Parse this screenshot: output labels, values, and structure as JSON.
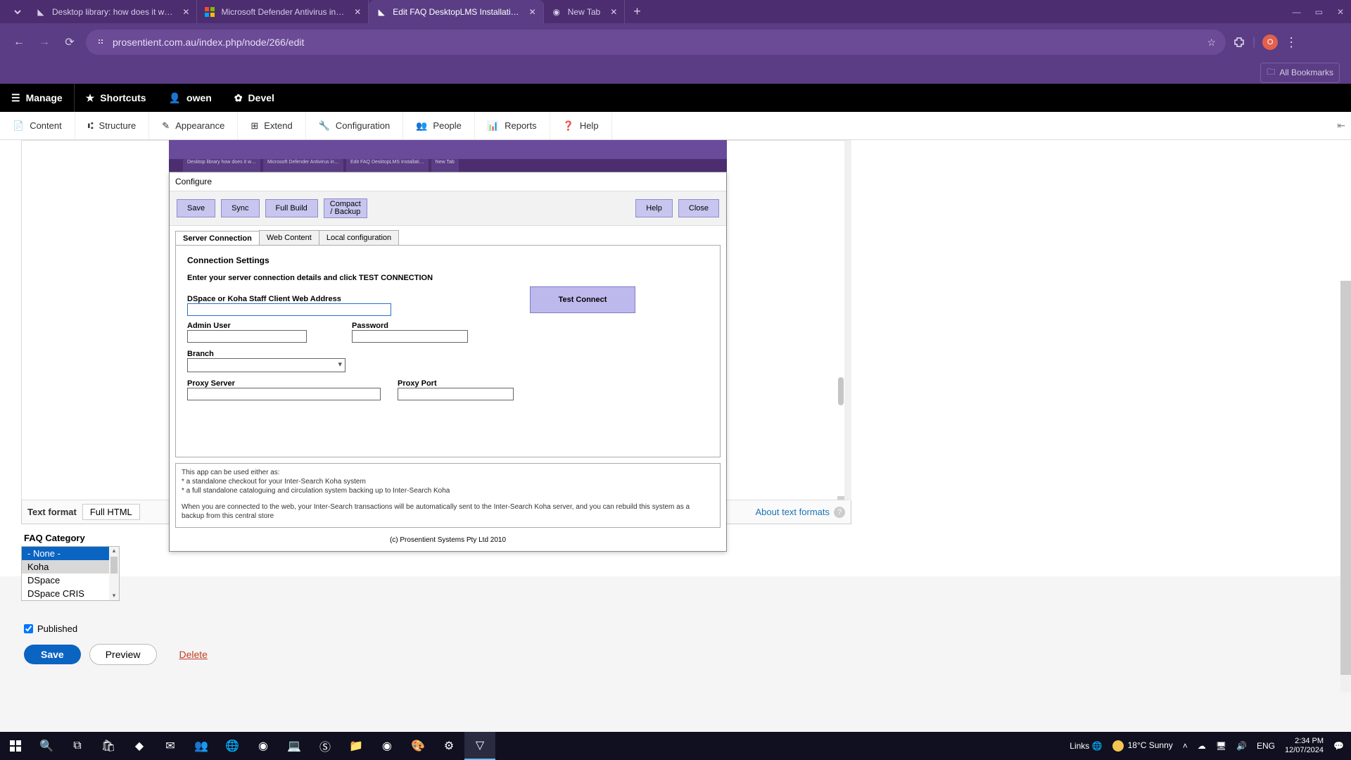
{
  "browser": {
    "tabs": [
      {
        "title": "Desktop library: how does it w…",
        "favicon": "◣"
      },
      {
        "title": "Microsoft Defender Antivirus in…",
        "favicon": "⊞"
      },
      {
        "title": "Edit FAQ DesktopLMS Installati…",
        "favicon": "◣",
        "active": true
      },
      {
        "title": "New Tab",
        "favicon": "◉"
      }
    ],
    "url": "prosentient.com.au/index.php/node/266/edit",
    "bookmarks_label": "All Bookmarks",
    "profile_initial": "O"
  },
  "drupal_bar": {
    "manage": "Manage",
    "shortcuts": "Shortcuts",
    "user": "owen",
    "devel": "Devel"
  },
  "drupal_sub": {
    "items": [
      "Content",
      "Structure",
      "Appearance",
      "Extend",
      "Configuration",
      "People",
      "Reports",
      "Help"
    ]
  },
  "editor": {
    "text_format_label": "Text format",
    "text_format_value": "Full HTML",
    "about_formats": "About text formats"
  },
  "faq": {
    "label": "FAQ Category",
    "options": [
      "- None -",
      "Koha",
      "DSpace",
      "DSpace CRIS"
    ],
    "selected": "- None -"
  },
  "published": {
    "label": "Published",
    "checked": true
  },
  "actions": {
    "save": "Save",
    "preview": "Preview",
    "delete": "Delete"
  },
  "configure": {
    "title": "Configure",
    "toolbar": {
      "save": "Save",
      "sync": "Sync",
      "full_build": "Full Build",
      "compact": "Compact\n/ Backup",
      "help": "Help",
      "close": "Close"
    },
    "tabs": [
      "Server Connection",
      "Web Content",
      "Local configuration"
    ],
    "heading": "Connection Settings",
    "subhead": "Enter your server connection details and click TEST CONNECTION",
    "labels": {
      "webaddr": "DSpace or Koha Staff Client Web Address",
      "admin": "Admin User",
      "password": "Password",
      "branch": "Branch",
      "proxy": "Proxy Server",
      "proxyport": "Proxy Port"
    },
    "test_connect": "Test Connect",
    "info_l1": "This app can be used either as:",
    "info_l2": "* a standalone checkout for your Inter-Search Koha system",
    "info_l3": "* a full standalone cataloguing and circulation system backing up to Inter-Search Koha",
    "info_l4": "When you are connected to the web, your Inter-Search transactions will be automatically sent to the Inter-Search Koha server, and you can rebuild this system as a backup from this central store",
    "footer": "(c) Prosentient Systems Pty Ltd 2010"
  },
  "taskbar": {
    "links": "Links",
    "weather": "18°C  Sunny",
    "lang": "ENG",
    "time": "2:34 PM",
    "date": "12/07/2024"
  }
}
